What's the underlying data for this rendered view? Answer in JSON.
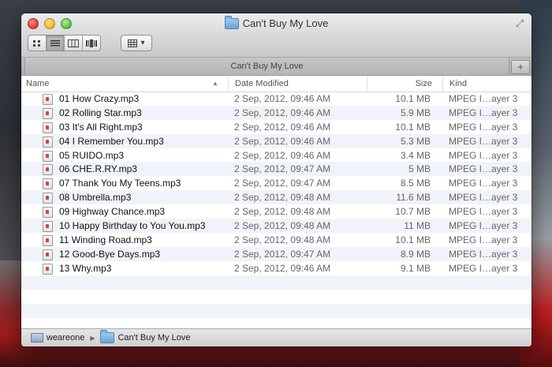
{
  "window": {
    "title": "Can't Buy My Love"
  },
  "toolbar": {
    "view_buttons": [
      "icon-view",
      "list-view",
      "column-view",
      "cover-flow-view"
    ],
    "active_view": "list-view"
  },
  "tab": {
    "label": "Can't Buy My Love",
    "add_label": "+"
  },
  "columns": {
    "name": "Name",
    "date": "Date Modified",
    "size": "Size",
    "kind": "Kind",
    "sort_indicator": "▲"
  },
  "files": [
    {
      "name": "01 How Crazy.mp3",
      "date": "2 Sep, 2012, 09:46 AM",
      "size": "10.1 MB",
      "kind": "MPEG I…ayer 3"
    },
    {
      "name": "02 Rolling Star.mp3",
      "date": "2 Sep, 2012, 09:46 AM",
      "size": "5.9 MB",
      "kind": "MPEG I…ayer 3"
    },
    {
      "name": "03 It's All Right.mp3",
      "date": "2 Sep, 2012, 09:46 AM",
      "size": "10.1 MB",
      "kind": "MPEG I…ayer 3"
    },
    {
      "name": "04 I Remember You.mp3",
      "date": "2 Sep, 2012, 09:46 AM",
      "size": "5.3 MB",
      "kind": "MPEG I…ayer 3"
    },
    {
      "name": "05 RUIDO.mp3",
      "date": "2 Sep, 2012, 09:46 AM",
      "size": "3.4 MB",
      "kind": "MPEG I…ayer 3"
    },
    {
      "name": "06 CHE.R.RY.mp3",
      "date": "2 Sep, 2012, 09:47 AM",
      "size": "5 MB",
      "kind": "MPEG I…ayer 3"
    },
    {
      "name": "07 Thank You My Teens.mp3",
      "date": "2 Sep, 2012, 09:47 AM",
      "size": "8.5 MB",
      "kind": "MPEG I…ayer 3"
    },
    {
      "name": "08 Umbrella.mp3",
      "date": "2 Sep, 2012, 09:48 AM",
      "size": "11.6 MB",
      "kind": "MPEG I…ayer 3"
    },
    {
      "name": "09 Highway Chance.mp3",
      "date": "2 Sep, 2012, 09:48 AM",
      "size": "10.7 MB",
      "kind": "MPEG I…ayer 3"
    },
    {
      "name": "10 Happy Birthday to You You.mp3",
      "date": "2 Sep, 2012, 09:48 AM",
      "size": "11 MB",
      "kind": "MPEG I…ayer 3"
    },
    {
      "name": "11 Winding Road.mp3",
      "date": "2 Sep, 2012, 09:48 AM",
      "size": "10.1 MB",
      "kind": "MPEG I…ayer 3"
    },
    {
      "name": "12 Good-Bye Days.mp3",
      "date": "2 Sep, 2012, 09:47 AM",
      "size": "8.9 MB",
      "kind": "MPEG I…ayer 3"
    },
    {
      "name": "13 Why.mp3",
      "date": "2 Sep, 2012, 09:46 AM",
      "size": "9.1 MB",
      "kind": "MPEG I…ayer 3"
    }
  ],
  "pathbar": {
    "items": [
      "weareone",
      "Can't Buy My Love"
    ]
  }
}
